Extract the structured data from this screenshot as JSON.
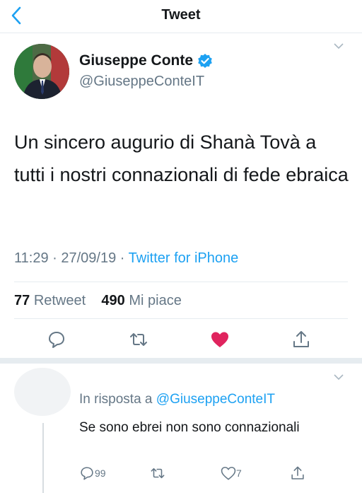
{
  "header": {
    "title": "Tweet"
  },
  "tweet": {
    "author_name": "Giuseppe Conte",
    "author_handle": "@GiuseppeConteIT",
    "text": "Un sincero augurio di Shanà Tovà a tutti i nostri connazionali di fede ebraica",
    "time": "11:29",
    "date": "27/09/19",
    "client": "Twitter for iPhone",
    "retweet_count": "77",
    "retweet_label": "Retweet",
    "like_count": "490",
    "like_label": "Mi piace",
    "like_color": "#e0245e",
    "accent_color": "#1da1f2"
  },
  "reply": {
    "prefix": "In risposta a",
    "mention": "@GiuseppeConteIT",
    "text": "Se sono ebrei non sono connazionali",
    "reply_count": "99",
    "like_count": "7"
  },
  "icons": [
    "back-chevron-icon",
    "verified-badge-icon",
    "more-chevron-icon",
    "reply-icon",
    "retweet-icon",
    "like-heart-icon",
    "share-icon"
  ]
}
